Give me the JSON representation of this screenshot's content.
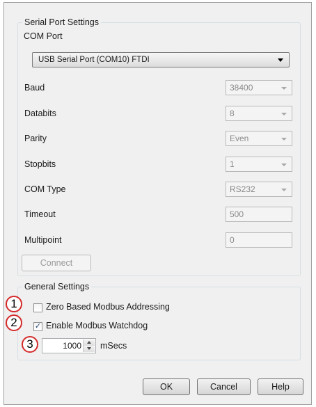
{
  "serial": {
    "legend": "Serial Port Settings",
    "com_port_label": "COM Port",
    "com_port_value": "USB Serial Port (COM10) FTDI",
    "rows": [
      {
        "label": "Baud",
        "value": "38400",
        "dropdown": true
      },
      {
        "label": "Databits",
        "value": "8",
        "dropdown": true
      },
      {
        "label": "Parity",
        "value": "Even",
        "dropdown": true
      },
      {
        "label": "Stopbits",
        "value": "1",
        "dropdown": true
      },
      {
        "label": "COM Type",
        "value": "RS232",
        "dropdown": true
      },
      {
        "label": "Timeout",
        "value": "500",
        "dropdown": false
      },
      {
        "label": "Multipoint",
        "value": "0",
        "dropdown": false
      }
    ],
    "connect_label": "Connect"
  },
  "general": {
    "legend": "General Settings",
    "zero_based_label": "Zero Based Modbus Addressing",
    "zero_based_checked": false,
    "watchdog_label": "Enable Modbus Watchdog",
    "watchdog_checked": true,
    "watchdog_value": "1000",
    "watchdog_unit": "mSecs"
  },
  "callouts": [
    "1",
    "2",
    "3"
  ],
  "icons": {
    "checkmark": "✓"
  },
  "buttons": {
    "ok": "OK",
    "cancel": "Cancel",
    "help": "Help"
  },
  "colors": {
    "callout_border": "#d42a2a"
  }
}
